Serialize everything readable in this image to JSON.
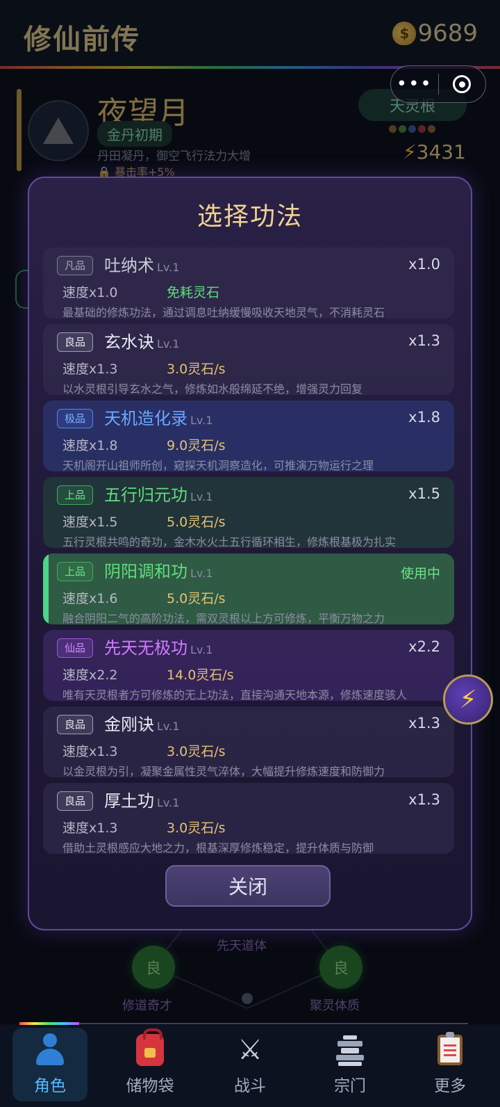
{
  "header": {
    "title": "修仙前传",
    "coin_icon": "money-bag-icon",
    "coins": "9689"
  },
  "profile": {
    "name": "夜望月",
    "realm": "金丹初期",
    "description": "丹田凝丹，御空飞行法力大增",
    "crit": "暴击率+5%",
    "root": "天灵根",
    "root_dots": [
      "#8a6a2a",
      "#4a8a3a",
      "#3a5aa8",
      "#a83a3a",
      "#8a6a2a"
    ],
    "power": "3431"
  },
  "background_nodes": [
    {
      "badge": "良",
      "label": "修道奇才"
    },
    {
      "badge": "良",
      "label": "聚灵体质"
    }
  ],
  "background_center_label": "先天道体",
  "modal": {
    "title": "选择功法",
    "close_label": "关闭",
    "methods": [
      {
        "grade": "凡品",
        "name": "吐纳术",
        "level": "Lv.1",
        "mult": "x1.0",
        "speed": "速度x1.0",
        "cost": "免耗灵石",
        "desc": "最基础的修炼功法，通过调息吐纳缓慢吸收天地灵气，不消耗灵石"
      },
      {
        "grade": "良品",
        "name": "玄水诀",
        "level": "Lv.1",
        "mult": "x1.3",
        "speed": "速度x1.3",
        "cost": "3.0灵石/s",
        "desc": "以水灵根引导玄水之气，修炼如水般绵延不绝，增强灵力回复"
      },
      {
        "grade": "极品",
        "name": "天机造化录",
        "level": "Lv.1",
        "mult": "x1.8",
        "speed": "速度x1.8",
        "cost": "9.0灵石/s",
        "desc": "天机阁开山祖师所创，窥探天机洞察造化，可推演万物运行之理"
      },
      {
        "grade": "上品",
        "name": "五行归元功",
        "level": "Lv.1",
        "mult": "x1.5",
        "speed": "速度x1.5",
        "cost": "5.0灵石/s",
        "desc": "五行灵根共鸣的奇功，金木水火土五行循环相生，修炼根基极为扎实"
      },
      {
        "grade": "上品",
        "name": "阴阳调和功",
        "level": "Lv.1",
        "mult": "使用中",
        "speed": "速度x1.6",
        "cost": "5.0灵石/s",
        "desc": "融合阴阳二气的高阶功法，需双灵根以上方可修炼，平衡万物之力"
      },
      {
        "grade": "仙品",
        "name": "先天无极功",
        "level": "Lv.1",
        "mult": "x2.2",
        "speed": "速度x2.2",
        "cost": "14.0灵石/s",
        "desc": "唯有天灵根者方可修炼的无上功法，直接沟通天地本源，修炼速度骇人"
      },
      {
        "grade": "良品",
        "name": "金刚诀",
        "level": "Lv.1",
        "mult": "x1.3",
        "speed": "速度x1.3",
        "cost": "3.0灵石/s",
        "desc": "以金灵根为引，凝聚金属性灵气淬体，大幅提升修炼速度和防御力"
      },
      {
        "grade": "良品",
        "name": "厚土功",
        "level": "Lv.1",
        "mult": "x1.3",
        "speed": "速度x1.3",
        "cost": "3.0灵石/s",
        "desc": "借助土灵根感应大地之力，根基深厚修炼稳定，提升体质与防御"
      }
    ]
  },
  "bottom_nav": [
    {
      "label": "角色",
      "icon": "user-icon"
    },
    {
      "label": "储物袋",
      "icon": "backpack-icon"
    },
    {
      "label": "战斗",
      "icon": "crossed-swords-icon"
    },
    {
      "label": "宗门",
      "icon": "temple-icon"
    },
    {
      "label": "更多",
      "icon": "clipboard-icon"
    }
  ]
}
